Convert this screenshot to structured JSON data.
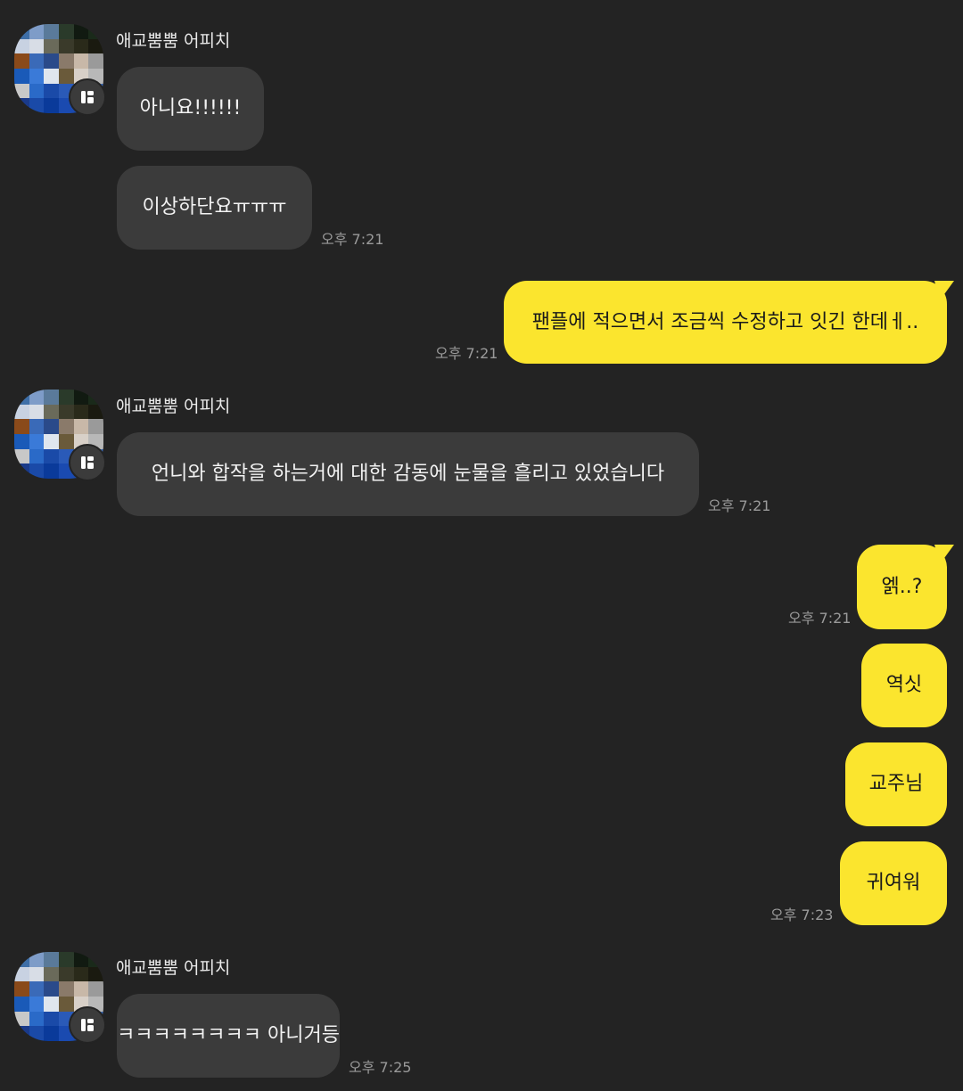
{
  "colors": {
    "background": "#232323",
    "incoming_bubble": "#3b3b3b",
    "outgoing_bubble": "#fbe52e",
    "timestamp": "#9a9a9a"
  },
  "avatar_icon": "pixelated-profile-photo",
  "badge_icon": "app-badge-icon",
  "groups": [
    {
      "sender": "애교뿜뿜 어피치",
      "messages": [
        "아니요!!!!!!",
        "이상하단요ㅠㅠㅠ"
      ],
      "time": "오후 7:21"
    },
    {
      "sender": "애교뿜뿜 어피치",
      "messages": [
        "언니와 합작을 하는거에 대한 감동에 눈물을 흘리고 있었습니다"
      ],
      "time": "오후 7:21"
    },
    {
      "sender": "애교뿜뿜 어피치",
      "messages": [
        "ㅋㅋㅋㅋㅋㅋㅋㅋ 아니거등"
      ],
      "time": "오후 7:25"
    }
  ],
  "outgoing": [
    {
      "messages": [
        "팬플에 적으면서 조금씩 수정하고 잇긴 한데ㅔ.."
      ],
      "time": "오후 7:21"
    },
    {
      "messages": [
        "엙..?"
      ],
      "time": "오후 7:21"
    },
    {
      "messages": [
        "역싯",
        "교주님",
        "귀여워"
      ],
      "time": "오후 7:23"
    }
  ]
}
